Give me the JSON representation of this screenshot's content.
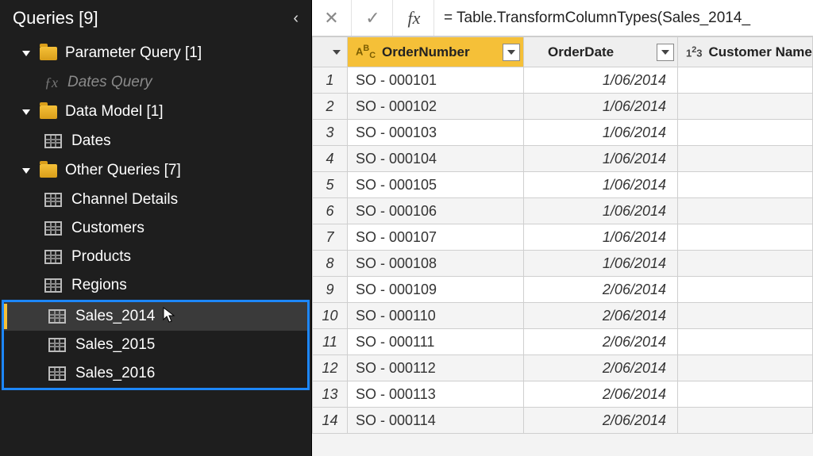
{
  "sidebar": {
    "title": "Queries [9]",
    "groups": [
      {
        "label": "Parameter Query [1]",
        "items": [
          {
            "label": "Dates Query",
            "kind": "fx"
          }
        ]
      },
      {
        "label": "Data Model [1]",
        "items": [
          {
            "label": "Dates",
            "kind": "table"
          }
        ]
      },
      {
        "label": "Other Queries [7]",
        "items": [
          {
            "label": "Channel Details",
            "kind": "table"
          },
          {
            "label": "Customers",
            "kind": "table"
          },
          {
            "label": "Products",
            "kind": "table"
          },
          {
            "label": "Regions",
            "kind": "table"
          },
          {
            "label": "Sales_2014",
            "kind": "table",
            "selected": true
          },
          {
            "label": "Sales_2015",
            "kind": "table"
          },
          {
            "label": "Sales_2016",
            "kind": "table"
          }
        ]
      }
    ]
  },
  "formula_bar": {
    "fx_label": "fx",
    "formula": "= Table.TransformColumnTypes(Sales_2014_"
  },
  "columns": [
    {
      "type_icon": "ABC",
      "label": "OrderNumber",
      "selected": true
    },
    {
      "type_icon": "date",
      "label": "OrderDate"
    },
    {
      "type_icon": "123",
      "label": "Customer Name"
    }
  ],
  "rows": [
    {
      "n": "1",
      "order": "SO - 000101",
      "date": "1/06/2014"
    },
    {
      "n": "2",
      "order": "SO - 000102",
      "date": "1/06/2014"
    },
    {
      "n": "3",
      "order": "SO - 000103",
      "date": "1/06/2014"
    },
    {
      "n": "4",
      "order": "SO - 000104",
      "date": "1/06/2014"
    },
    {
      "n": "5",
      "order": "SO - 000105",
      "date": "1/06/2014"
    },
    {
      "n": "6",
      "order": "SO - 000106",
      "date": "1/06/2014"
    },
    {
      "n": "7",
      "order": "SO - 000107",
      "date": "1/06/2014"
    },
    {
      "n": "8",
      "order": "SO - 000108",
      "date": "1/06/2014"
    },
    {
      "n": "9",
      "order": "SO - 000109",
      "date": "2/06/2014"
    },
    {
      "n": "10",
      "order": "SO - 000110",
      "date": "2/06/2014"
    },
    {
      "n": "11",
      "order": "SO - 000111",
      "date": "2/06/2014"
    },
    {
      "n": "12",
      "order": "SO - 000112",
      "date": "2/06/2014"
    },
    {
      "n": "13",
      "order": "SO - 000113",
      "date": "2/06/2014"
    },
    {
      "n": "14",
      "order": "SO - 000114",
      "date": "2/06/2014"
    }
  ]
}
